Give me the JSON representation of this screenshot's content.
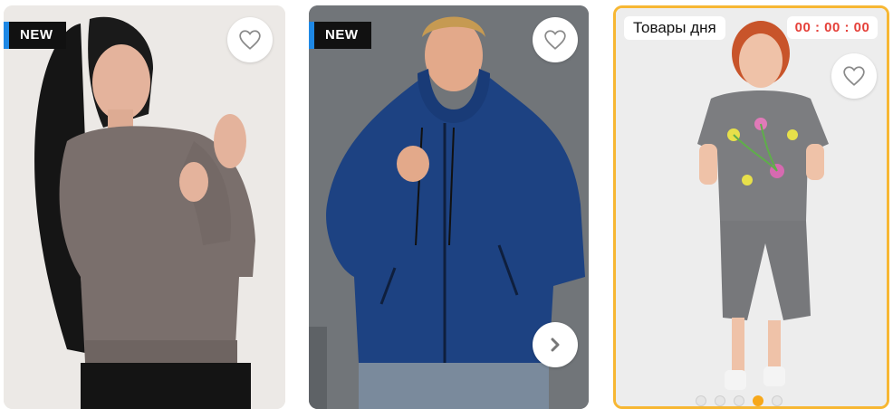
{
  "cards": [
    {
      "badge": "NEW",
      "favorite_icon": "heart-outline-icon",
      "image": "woman in gray sweatshirt",
      "colors": {
        "garment": "#7a6f6c",
        "background": "#ebe8e5"
      }
    },
    {
      "badge": "NEW",
      "favorite_icon": "heart-outline-icon",
      "next_icon": "chevron-right-icon",
      "image": "man in blue fleece hoodie",
      "colors": {
        "garment": "#1d4282",
        "background": "#6f7377"
      }
    },
    {
      "deal_label": "Товары дня",
      "timer": "00 : 00 : 00",
      "favorite_icon": "heart-outline-icon",
      "image": "woman in gray t-shirt and capri pants",
      "colors": {
        "garment": "#7c7d80",
        "accent": "#f7b733",
        "timer": "#e5413a"
      },
      "carousel": {
        "count": 5,
        "active_index": 3
      }
    }
  ]
}
